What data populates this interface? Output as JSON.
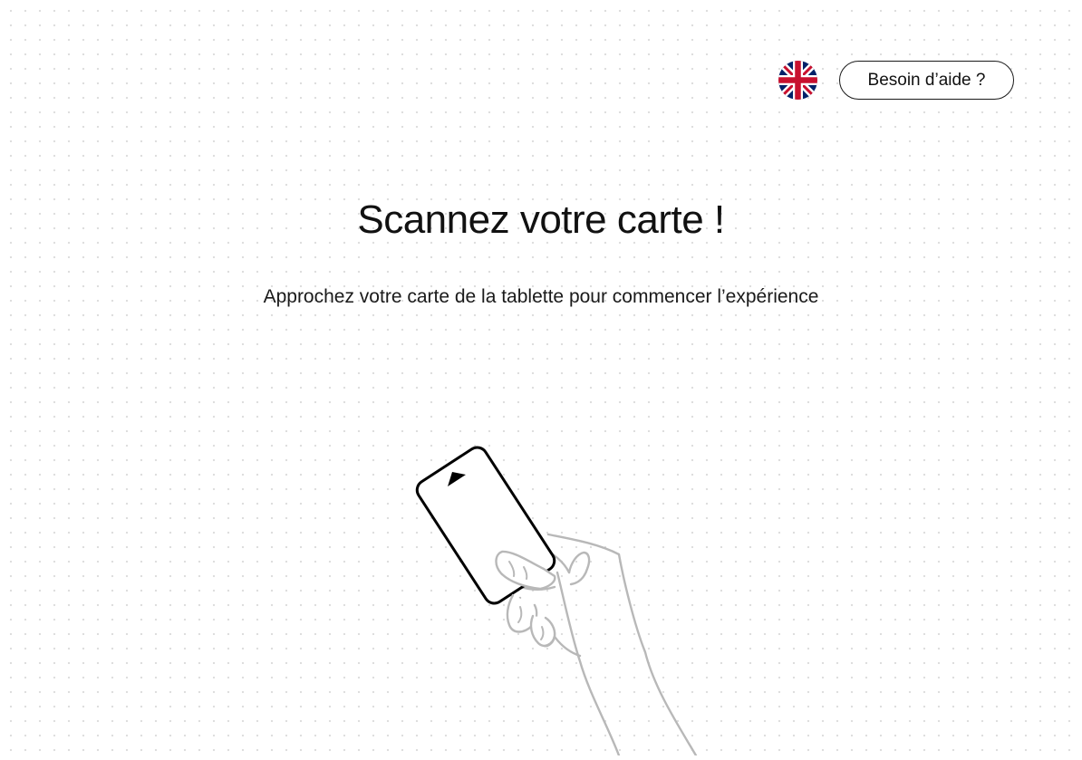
{
  "header": {
    "language_icon": "uk-flag-icon",
    "help_label": "Besoin d’aide ?"
  },
  "main": {
    "title": "Scannez votre carte !",
    "subtitle": "Approchez votre carte de la tablette pour commencer l’expérience",
    "illustration_icon": "hand-holding-card-icon"
  },
  "colors": {
    "background": "#ffffff",
    "text": "#111111",
    "dot_grid": "#dcdcdc",
    "hand_stroke": "#b8b8b8",
    "card_stroke": "#000000",
    "flag_blue": "#012169",
    "flag_red": "#C8102E"
  }
}
